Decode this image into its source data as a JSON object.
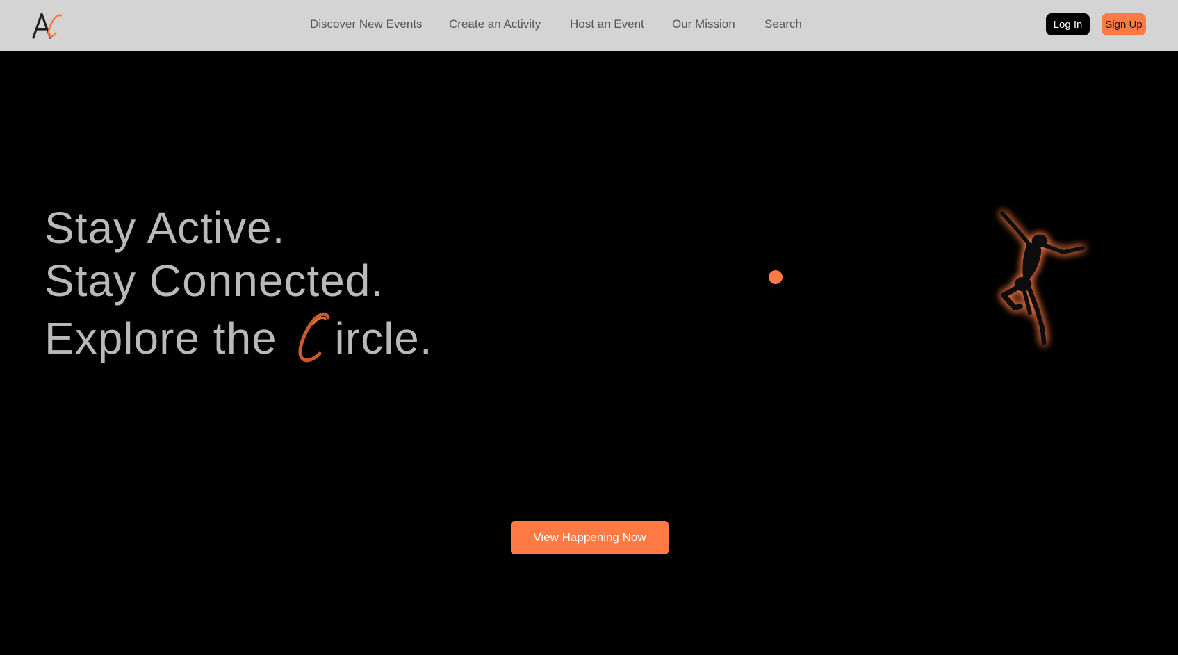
{
  "brand": {
    "logo_text": "AC",
    "accent_color": "#ff7a45",
    "nav_bg_color": "#d4d4d4"
  },
  "nav": {
    "links": [
      {
        "label": "Discover New Events"
      },
      {
        "label": "Create an Activity"
      },
      {
        "label": "Host an Event"
      },
      {
        "label": "Our Mission"
      },
      {
        "label": "Search"
      }
    ],
    "login_label": "Log In",
    "signup_label": "Sign Up"
  },
  "hero": {
    "line1": "Stay Active.",
    "line2": "Stay Connected.",
    "line3_prefix": "Explore the ",
    "line3_script_letter": "C",
    "line3_suffix": "ircle.",
    "figure_icon": "jumping-dancer-silhouette",
    "cta_label": "View Happening Now"
  }
}
